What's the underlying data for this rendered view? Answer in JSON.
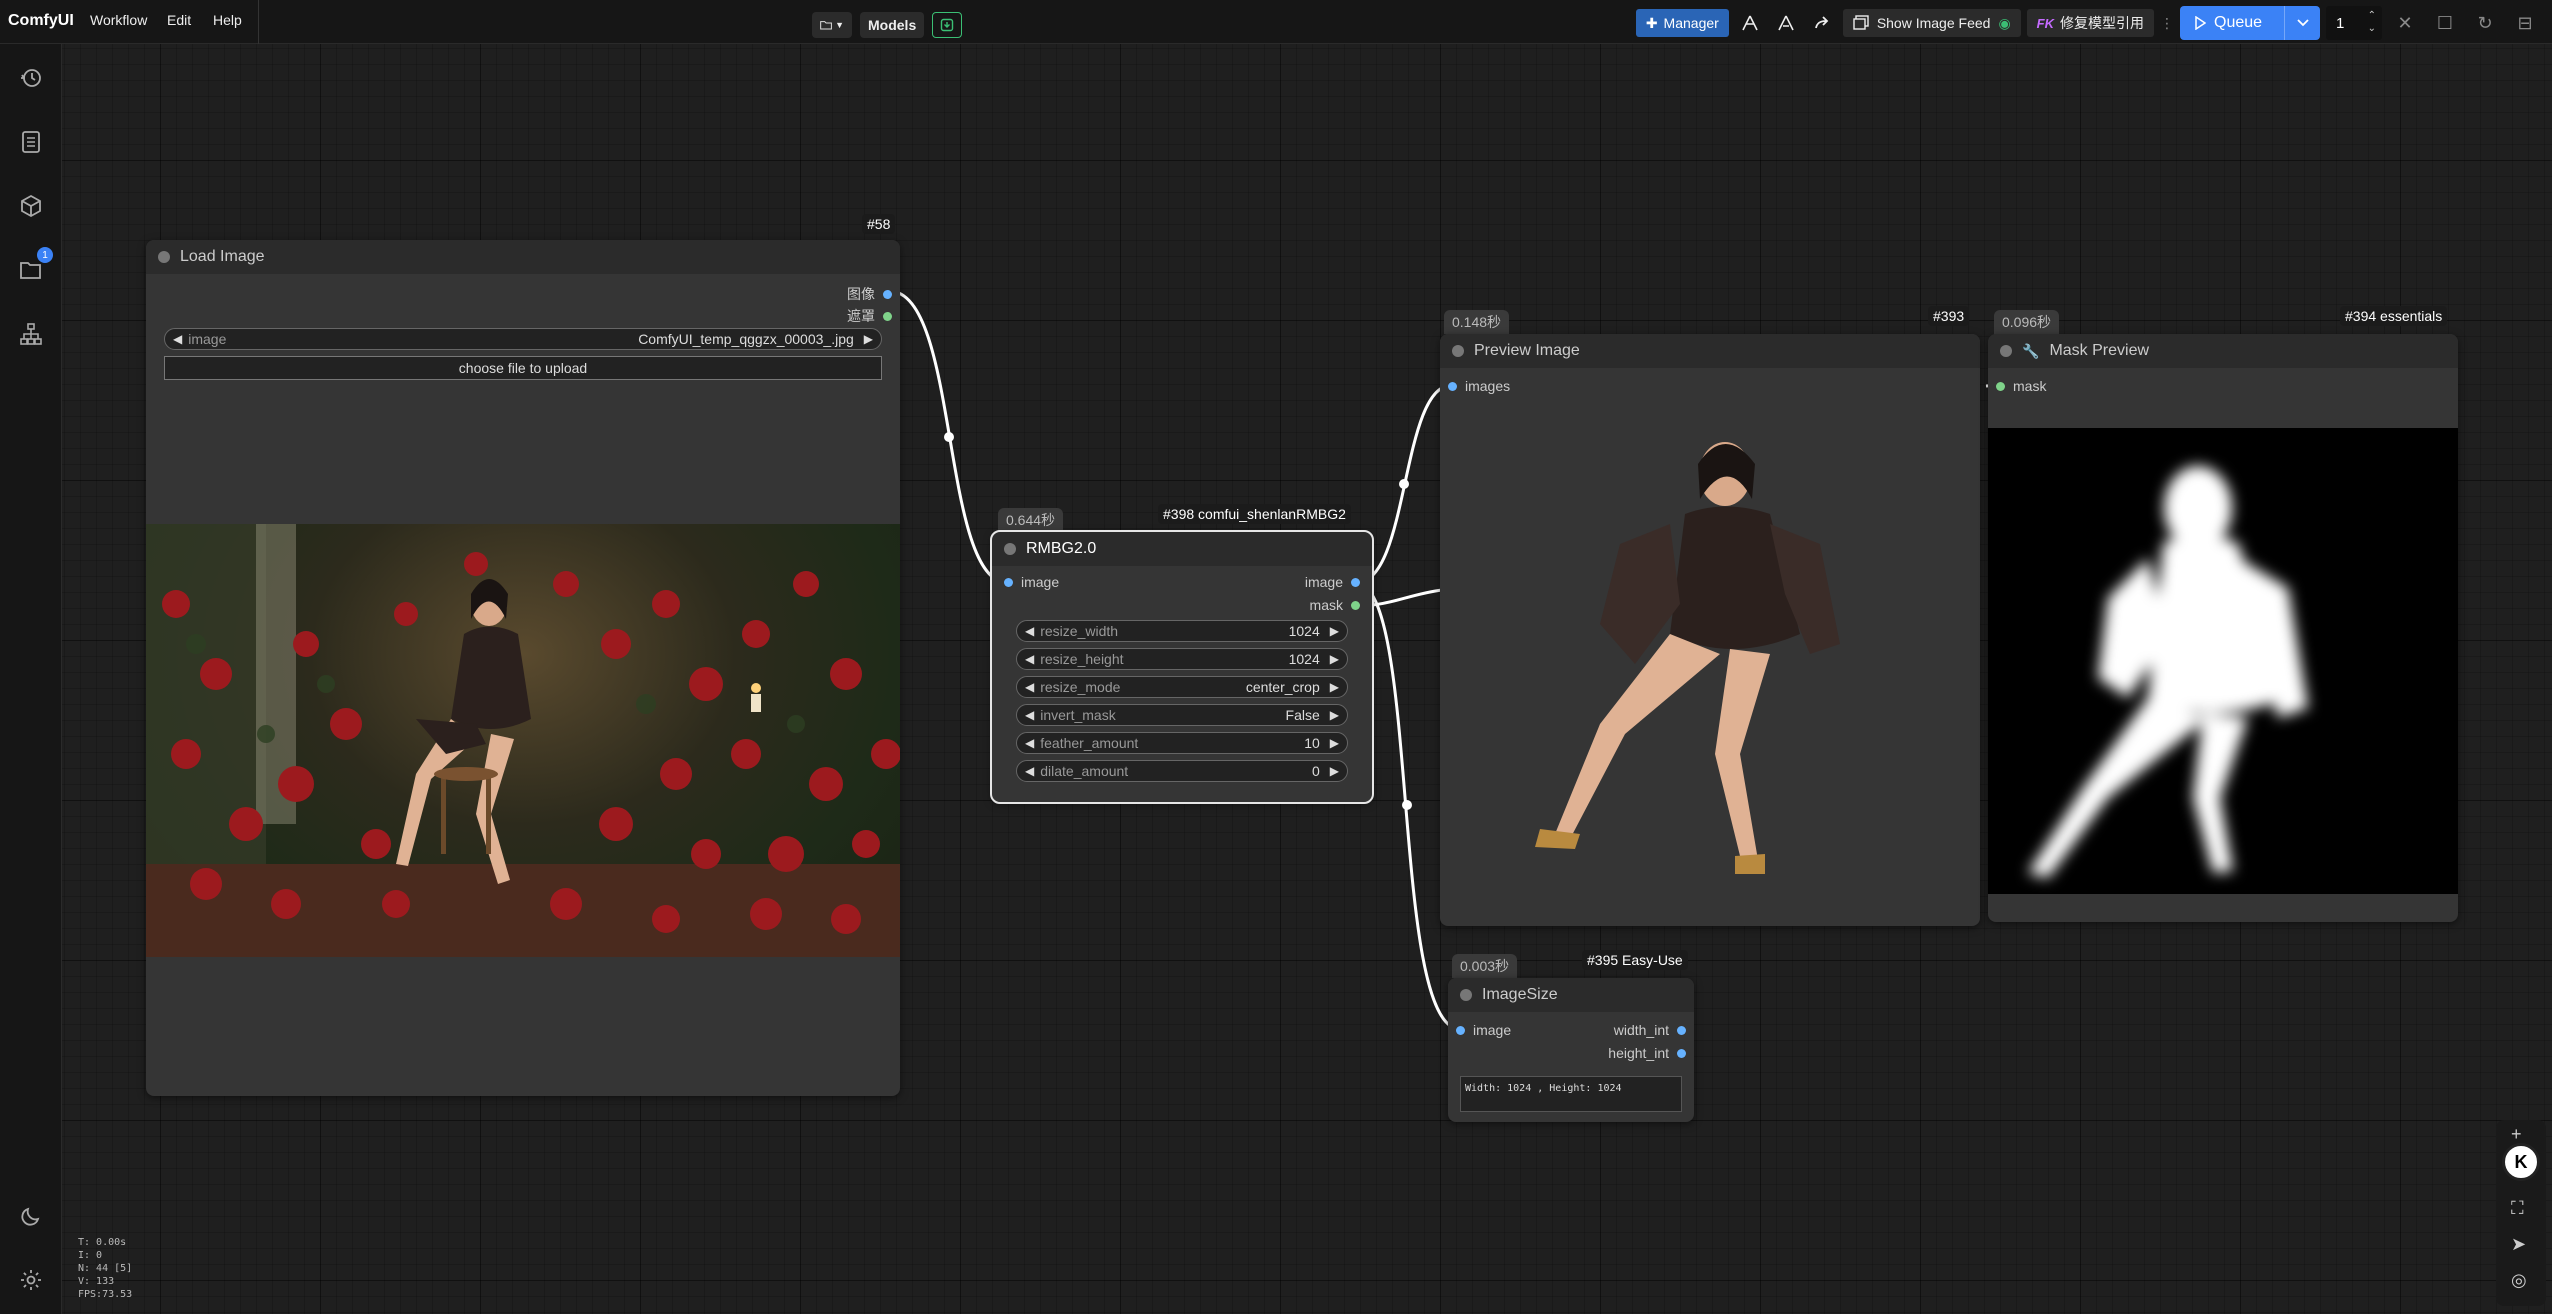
{
  "app": {
    "name": "ComfyUI"
  },
  "menu": [
    "Workflow",
    "Edit",
    "Help"
  ],
  "center": {
    "models_label": "Models"
  },
  "toolbar": {
    "manager_label": "Manager",
    "show_feed_label": "Show Image Feed",
    "fix_label": "修复模型引用",
    "fix_prefix": "FK",
    "queue_label": "Queue",
    "queue_count": "1"
  },
  "sidebar": {
    "icons": [
      "history-icon",
      "document-icon",
      "cube-icon",
      "folder-icon",
      "sitemap-icon"
    ],
    "folder_badge": "1",
    "bottom_icons": [
      "moon-icon",
      "settings-icon"
    ]
  },
  "stats": [
    "T: 0.00s",
    "I: 0",
    "N: 44 [5]",
    "V: 133",
    "FPS:73.53"
  ],
  "nodes": {
    "load_image": {
      "id_tag": "#58",
      "title": "Load Image",
      "out_image": "图像",
      "out_mask": "遮罩",
      "widget_label": "image",
      "widget_value": "ComfyUI_temp_qggzx_00003_.jpg",
      "upload_label": "choose file to upload"
    },
    "rmbg": {
      "id_tag": "#398 comfui_shenlanRMBG2",
      "time": "0.644秒",
      "title": "RMBG2.0",
      "in_image": "image",
      "out_image": "image",
      "out_mask": "mask",
      "widgets": [
        {
          "label": "resize_width",
          "value": "1024"
        },
        {
          "label": "resize_height",
          "value": "1024"
        },
        {
          "label": "resize_mode",
          "value": "center_crop"
        },
        {
          "label": "invert_mask",
          "value": "False"
        },
        {
          "label": "feather_amount",
          "value": "10"
        },
        {
          "label": "dilate_amount",
          "value": "0"
        }
      ]
    },
    "preview": {
      "id_tag": "#393",
      "time": "0.148秒",
      "title": "Preview Image",
      "in_images": "images"
    },
    "mask_preview": {
      "id_tag": "#394 essentials",
      "time": "0.096秒",
      "title": "Mask Preview",
      "in_mask": "mask"
    },
    "image_size": {
      "id_tag": "#395 Easy-Use",
      "time": "0.003秒",
      "title": "ImageSize",
      "in_image": "image",
      "out_width": "width_int",
      "out_height": "height_int",
      "text": "Width: 1024 , Height: 1024"
    }
  },
  "colors": {
    "accent_blue": "#3b82f6",
    "manager_blue": "#2a65b6",
    "slot_image": "#66b2ff",
    "slot_mask": "#7fd38a",
    "rose_red": "#9c1a1e"
  }
}
